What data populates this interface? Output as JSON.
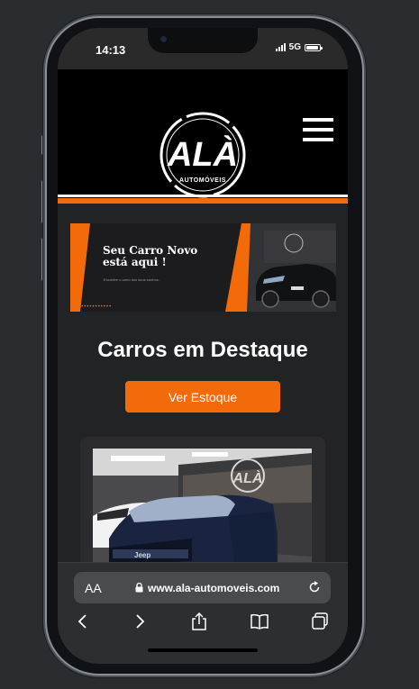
{
  "status_bar": {
    "time": "14:13",
    "network": "5G",
    "battery_level": 0.9
  },
  "site": {
    "logo_text": "ALÀ",
    "logo_subtext": "AUTOMÓVEIS",
    "menu_icon": "hamburger-menu-icon",
    "accent_color": "#f26a0a"
  },
  "banner": {
    "title_line1": "Seu Carro Novo",
    "title_line2": "está aqui !",
    "subtitle": "Encontre o carro dos seus sonhos.",
    "dots": "••••••••••••"
  },
  "main": {
    "section_title": "Carros em Destaque",
    "cta_label": "Ver Estoque"
  },
  "browser": {
    "text_size_label": "AA",
    "url": "www.ala-automoveis.com",
    "icons": [
      "back-icon",
      "forward-icon",
      "share-icon",
      "bookmarks-icon",
      "tabs-icon"
    ]
  }
}
